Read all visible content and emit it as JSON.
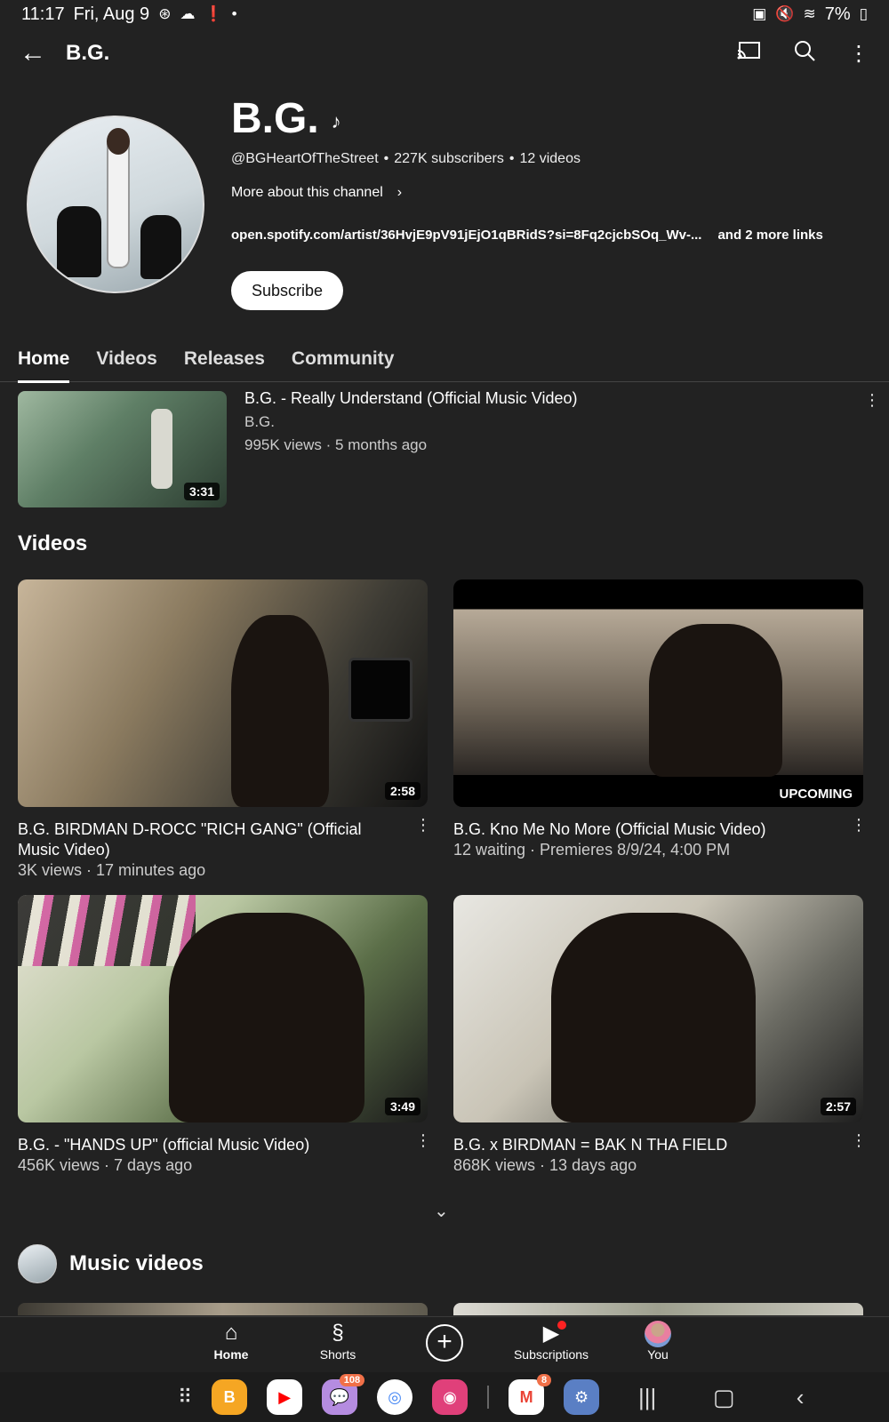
{
  "status": {
    "time": "11:17",
    "date": "Fri, Aug 9",
    "battery": "7%"
  },
  "appbar": {
    "title": "B.G."
  },
  "channel": {
    "name": "B.G.",
    "handle": "@BGHeartOfTheStreet",
    "subscribers": "227K subscribers",
    "videos": "12 videos",
    "more_about": "More about this channel",
    "link": "open.spotify.com/artist/36HvjE9pV91jEjO1qBRidS?si=8Fq2cjcbSOq_Wv-...",
    "more_links": "and 2 more links",
    "subscribe_label": "Subscribe"
  },
  "tabs": [
    {
      "label": "Home",
      "active": true
    },
    {
      "label": "Videos"
    },
    {
      "label": "Releases"
    },
    {
      "label": "Community"
    }
  ],
  "featured": {
    "title": "B.G. -  Really Understand (Official Music Video)",
    "channel": "B.G.",
    "stats": "995K views · 5 months ago",
    "duration": "3:31"
  },
  "videos_section": {
    "title": "Videos",
    "items": [
      {
        "title": "B.G. BIRDMAN D-ROCC \"RICH GANG\" (Official Music Video)",
        "stats": "3K views · 17 minutes ago",
        "duration": "2:58"
      },
      {
        "title": "B.G. Kno Me No More (Official Music Video)",
        "stats": "12 waiting · Premieres 8/9/24, 4:00 PM",
        "badge": "UPCOMING"
      },
      {
        "title": "B.G.  -  \"HANDS UP\" (official Music Video)",
        "stats": "456K views · 7 days ago",
        "duration": "3:49"
      },
      {
        "title": "B.G. x BIRDMAN = BAK N THA FIELD",
        "stats": "868K views · 13 days ago",
        "duration": "2:57"
      }
    ]
  },
  "music_section": {
    "title": "Music videos"
  },
  "bottom_nav": {
    "home": "Home",
    "shorts": "Shorts",
    "subscriptions": "Subscriptions",
    "you": "You"
  },
  "system_bar": {
    "messages_badge": "108",
    "gmail_badge": "8"
  },
  "colors": {
    "background": "#222222",
    "subscribe_bg": "#ffffff",
    "notification_dot": "#ff2222",
    "youtube_red": "#ff0000"
  }
}
